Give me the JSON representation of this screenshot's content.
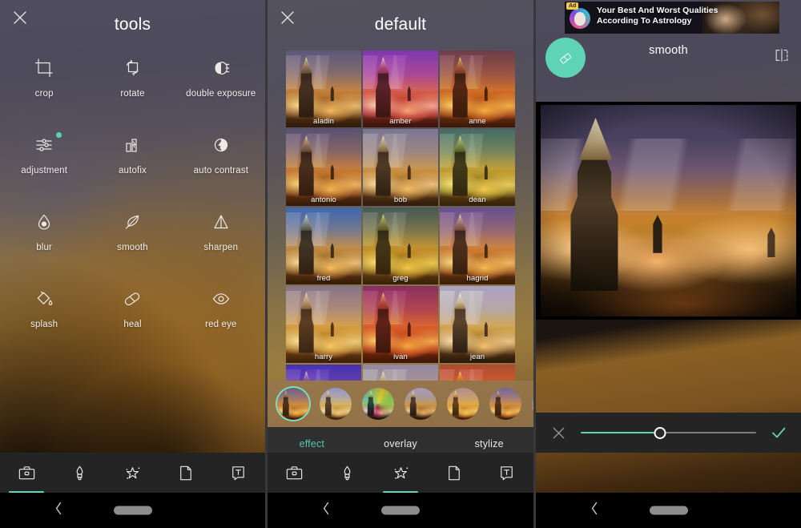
{
  "colors": {
    "accent_teal": "#5fd3b6",
    "tab_active": "#57c5ac",
    "nav_bg": "#242424",
    "system_bg": "#000000",
    "badge_dot": "#4fd6b4",
    "ad_badge": "#f2c94c"
  },
  "screen1": {
    "title": "tools",
    "close_label": "×",
    "tools": [
      {
        "id": "crop",
        "label": "crop",
        "icon": "crop-icon",
        "badge": false
      },
      {
        "id": "rotate",
        "label": "rotate",
        "icon": "rotate-icon",
        "badge": false
      },
      {
        "id": "double_exposure",
        "label": "double exposure",
        "icon": "double-exposure-icon",
        "badge": false
      },
      {
        "id": "adjustment",
        "label": "adjustment",
        "icon": "sliders-icon",
        "badge": true
      },
      {
        "id": "autofix",
        "label": "autofix",
        "icon": "autofix-icon",
        "badge": false
      },
      {
        "id": "auto_contrast",
        "label": "auto contrast",
        "icon": "contrast-bolt-icon",
        "badge": false
      },
      {
        "id": "blur",
        "label": "blur",
        "icon": "droplet-icon",
        "badge": false
      },
      {
        "id": "smooth",
        "label": "smooth",
        "icon": "feather-icon",
        "badge": false
      },
      {
        "id": "sharpen",
        "label": "sharpen",
        "icon": "triangle-icon",
        "badge": false
      },
      {
        "id": "splash",
        "label": "splash",
        "icon": "paint-bucket-icon",
        "badge": false
      },
      {
        "id": "heal",
        "label": "heal",
        "icon": "bandage-icon",
        "badge": false
      },
      {
        "id": "red_eye",
        "label": "red eye",
        "icon": "eye-icon",
        "badge": false
      }
    ],
    "nav": {
      "active_index": 0,
      "items": [
        {
          "id": "tools",
          "icon": "toolbox-icon"
        },
        {
          "id": "brush",
          "icon": "brush-icon"
        },
        {
          "id": "effects",
          "icon": "magic-stars-icon"
        },
        {
          "id": "frames",
          "icon": "page-icon"
        },
        {
          "id": "text",
          "icon": "text-icon"
        }
      ]
    }
  },
  "screen2": {
    "title": "default",
    "close_label": "×",
    "filters": [
      {
        "name": "aladin",
        "row": 1,
        "col": 1
      },
      {
        "name": "amber",
        "row": 1,
        "col": 2
      },
      {
        "name": "anne",
        "row": 1,
        "col": 3
      },
      {
        "name": "antonio",
        "row": 2,
        "col": 1
      },
      {
        "name": "bob",
        "row": 2,
        "col": 2
      },
      {
        "name": "dean",
        "row": 2,
        "col": 3
      },
      {
        "name": "fred",
        "row": 3,
        "col": 1
      },
      {
        "name": "greg",
        "row": 3,
        "col": 2
      },
      {
        "name": "hagrid",
        "row": 3,
        "col": 3
      },
      {
        "name": "harry",
        "row": 4,
        "col": 1
      },
      {
        "name": "ivan",
        "row": 4,
        "col": 2
      },
      {
        "name": "jean",
        "row": 4,
        "col": 3
      },
      {
        "name": "",
        "row": 5,
        "col": 1
      },
      {
        "name": "",
        "row": 5,
        "col": 2
      },
      {
        "name": "",
        "row": 5,
        "col": 3
      }
    ],
    "filmstrip": {
      "selected_index": 0,
      "count": 7
    },
    "tabs": {
      "active": "effect",
      "items": [
        "effect",
        "overlay",
        "stylize"
      ]
    },
    "nav": {
      "active_index": 2,
      "items": [
        {
          "id": "tools",
          "icon": "toolbox-icon"
        },
        {
          "id": "brush",
          "icon": "brush-icon"
        },
        {
          "id": "effects",
          "icon": "magic-stars-icon"
        },
        {
          "id": "frames",
          "icon": "page-icon"
        },
        {
          "id": "text",
          "icon": "text-icon"
        }
      ]
    }
  },
  "screen3": {
    "ad": {
      "badge": "Ad",
      "line1": "Your Best And Worst Qualities",
      "line2": "According To Astrology"
    },
    "title": "smooth",
    "eraser_icon": "eraser-icon",
    "compare_icon": "compare-split-icon",
    "slider": {
      "value_percent": 45,
      "cancel_icon": "close-icon",
      "confirm_icon": "check-icon"
    }
  },
  "system": {
    "back_icon": "chevron-left-icon",
    "home_pill": "home-pill"
  }
}
